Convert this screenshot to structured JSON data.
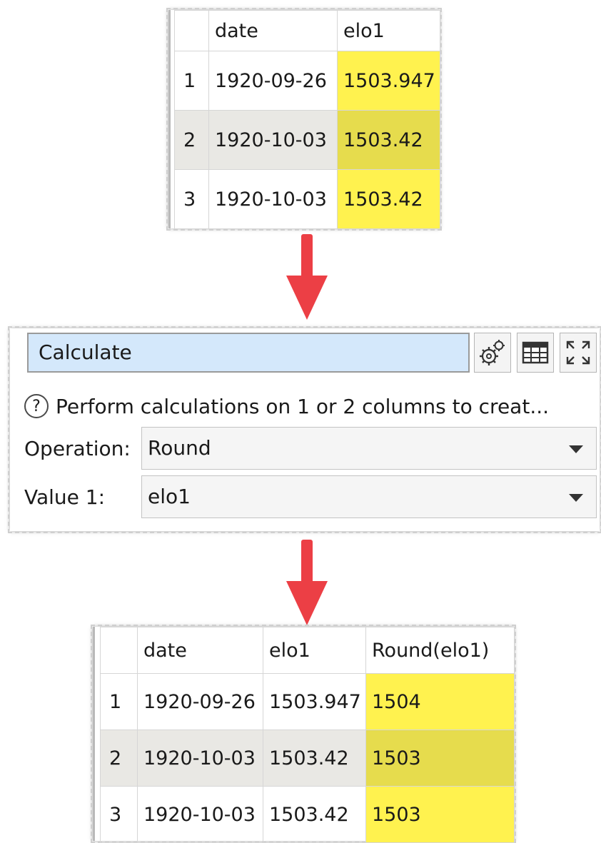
{
  "input_table": {
    "columns": [
      "date",
      "elo1"
    ],
    "rows": [
      {
        "n": "1",
        "date": "1920-09-26",
        "elo1": "1503.947"
      },
      {
        "n": "2",
        "date": "1920-10-03",
        "elo1": "1503.42"
      },
      {
        "n": "3",
        "date": "1920-10-03",
        "elo1": "1503.42"
      }
    ]
  },
  "calculate_panel": {
    "title": "Calculate",
    "description": "Perform calculations on 1 or 2 columns to creat...",
    "help_glyph": "?",
    "operation_label": "Operation:",
    "operation_value": "Round",
    "value1_label": "Value 1:",
    "value1_value": "elo1",
    "icons": [
      "settings-gears-icon",
      "table-icon",
      "expand-icon"
    ]
  },
  "output_table": {
    "columns": [
      "date",
      "elo1",
      "Round(elo1)"
    ],
    "rows": [
      {
        "n": "1",
        "date": "1920-09-26",
        "elo1": "1503.947",
        "round": "1504"
      },
      {
        "n": "2",
        "date": "1920-10-03",
        "elo1": "1503.42",
        "round": "1503"
      },
      {
        "n": "3",
        "date": "1920-10-03",
        "elo1": "1503.42",
        "round": "1503"
      }
    ]
  },
  "colors": {
    "highlight_yellow": "#fff24f",
    "highlight_yellow_selected": "#e6dc4d",
    "row_selected_gray": "#e9e8e4",
    "arrow_red": "#ec3f45",
    "title_blue": "#d4e8fb"
  }
}
